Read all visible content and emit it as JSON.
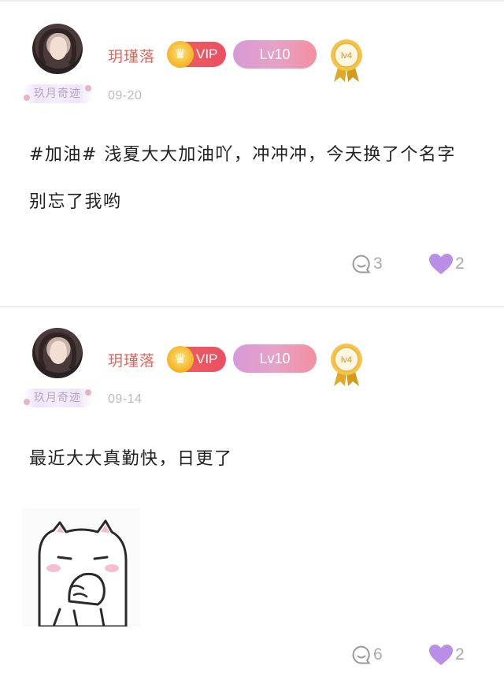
{
  "posts": [
    {
      "username": "玥瑾落",
      "vip_label": "VIP",
      "level_label": "Lv10",
      "medal_text": "lv4",
      "frame_text": "玖月奇迹",
      "date": "09-20",
      "content_lines": [
        "#加油# 浅夏大大加油吖，冲冲冲，今天换了个名字",
        "别忘了我哟"
      ],
      "comments": "3",
      "likes": "2"
    },
    {
      "username": "玥瑾落",
      "vip_label": "VIP",
      "level_label": "Lv10",
      "medal_text": "lv4",
      "frame_text": "玖月奇迹",
      "date": "09-14",
      "content_lines": [
        "最近大大真勤快，日更了"
      ],
      "comments": "6",
      "likes": "2"
    }
  ],
  "icons": {
    "comment": "comment-bubble-icon",
    "like": "heart-icon",
    "crown": "crown-icon",
    "medal": "medal-icon"
  },
  "colors": {
    "username": "#e2665a",
    "vip": "#ee5b5f",
    "level_gradient_start": "#d79ad8",
    "level_gradient_end": "#f38fa1",
    "heart": "#b88fe6",
    "count": "#aaaaaa"
  }
}
